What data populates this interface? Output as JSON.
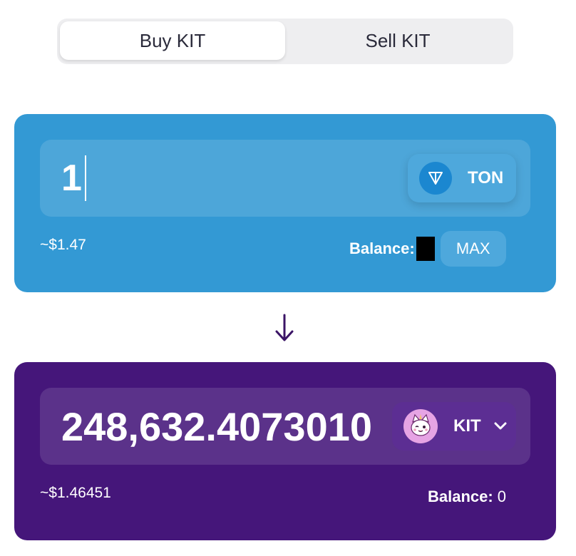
{
  "tabs": {
    "buy_label": "Buy KIT",
    "sell_label": "Sell KIT",
    "active": "buy"
  },
  "pay": {
    "amount": "1",
    "token": {
      "symbol": "TON",
      "icon": "ton-diamond-icon",
      "color": "#1b87d0"
    },
    "usd_value": "~$1.47",
    "balance_label": "Balance:",
    "balance_value": "",
    "max_label": "MAX",
    "card_color": "#3399d4"
  },
  "swap_direction_icon": "arrow-down-icon",
  "receive": {
    "amount": "248,632.4073010",
    "token": {
      "symbol": "KIT",
      "icon": "kit-cat-icon",
      "dropdown_icon": "chevron-down-icon"
    },
    "usd_value": "~$1.46451",
    "balance_label": "Balance:",
    "balance_value": "0",
    "card_color": "#45167a"
  }
}
